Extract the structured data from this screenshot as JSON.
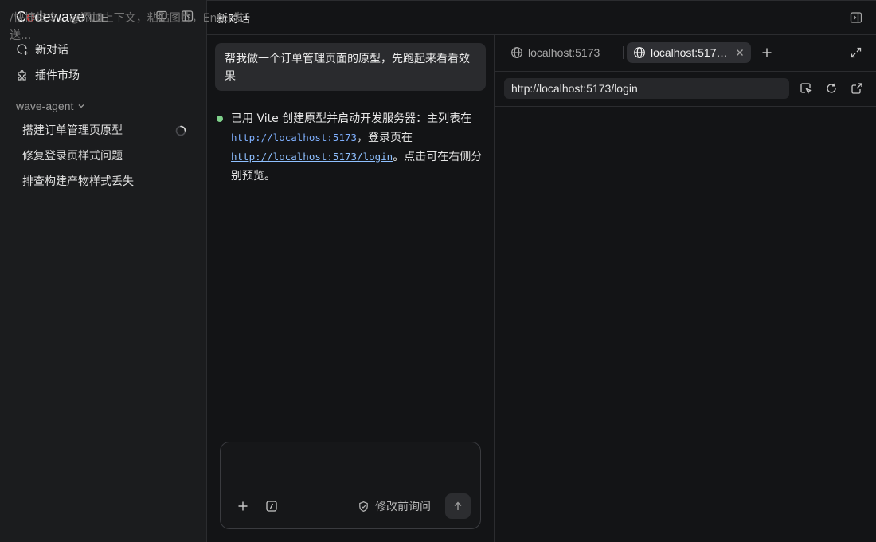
{
  "app": {
    "logo_text_pre": "C",
    "logo_text_o": "o",
    "logo_text_post": "dewave",
    "logo_suffix": "IDE"
  },
  "sidebar": {
    "nav": [
      {
        "label": "新对话",
        "icon": "new-chat-icon"
      },
      {
        "label": "插件市场",
        "icon": "puzzle-icon"
      }
    ],
    "group": {
      "label": "wave-agent"
    },
    "sessions": [
      {
        "label": "搭建订单管理页原型",
        "status": "running"
      },
      {
        "label": "修复登录页样式问题"
      },
      {
        "label": "排查构建产物样式丢失"
      }
    ]
  },
  "chat": {
    "title": "新对话",
    "user_message": "帮我做一个订单管理页面的原型，先跑起来看看效果",
    "reply": {
      "part1": "已用 Vite 创建原型并启动开发服务器：主列表在",
      "code1": "http://localhost:5173",
      "part2": "，登录页在",
      "code2": "http://localhost:5173/login",
      "part3": "。点击可在右侧分别预览。"
    },
    "composer": {
      "placeholder": "/快捷指令，@添加上下文，粘贴图片，Enter发送...",
      "ask_label": "修改前询问"
    }
  },
  "preview": {
    "tabs": [
      {
        "label": "localhost:5173",
        "active": false
      },
      {
        "label": "localhost:517…",
        "active": true
      }
    ],
    "url": "http://localhost:5173/login"
  }
}
